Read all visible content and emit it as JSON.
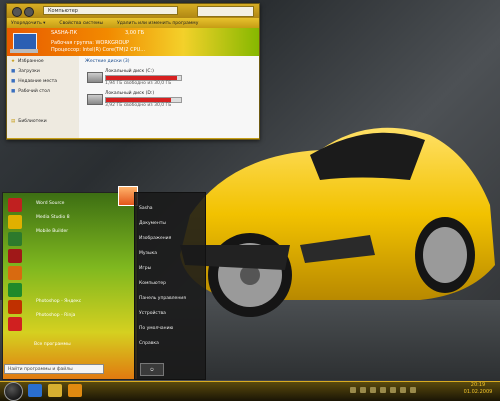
{
  "explorer": {
    "address": "Компьютер",
    "toolbar": [
      "Упорядочить ▾",
      "Свойства системы",
      "Удалить или изменить программу"
    ],
    "banner": {
      "name": "SASHA-ПК",
      "mem": "3,00 ГБ",
      "workgroup": "Рабочая группа: WORKGROUP",
      "cpu": "Процессор: Intel(R) Core(TM)2 CPU..."
    },
    "sidebar": [
      "Избранное",
      "Загрузки",
      "Недавние места",
      "Рабочий стол",
      "Библиотеки"
    ],
    "section_title": "Жесткие диски (3)",
    "drives": [
      {
        "name": "Локальный диск (C:)",
        "free": "1,94 ГБ свободно из 30,0 ГБ",
        "fill": 0.94,
        "color": "#d62020"
      },
      {
        "name": "Локальный диск (D:)",
        "free": "3,92 ГБ свободно из 30,0 ГБ",
        "fill": 0.87,
        "color": "#d62020"
      }
    ]
  },
  "start_menu": {
    "programs": [
      "Word Source",
      "Media Studio 8",
      "Mobile Builder",
      "",
      "",
      "",
      "",
      "Photoshop - Яндекс",
      "Photoshop - Rinja"
    ],
    "all_programs": "Все программы",
    "search_placeholder": "Найти программы и файлы",
    "right": [
      "Sasha",
      "Документы",
      "Изображения",
      "Музыка",
      "Игры",
      "Компьютер",
      "Панель управления",
      "Устройства",
      "По умолчанию",
      "Справка"
    ],
    "shutdown": "Завершение работы"
  },
  "taskbar": {
    "time": "20:19",
    "date": "01.02.2009"
  },
  "colors": {
    "accent": "#d9ab20",
    "car": "#f2c200"
  }
}
